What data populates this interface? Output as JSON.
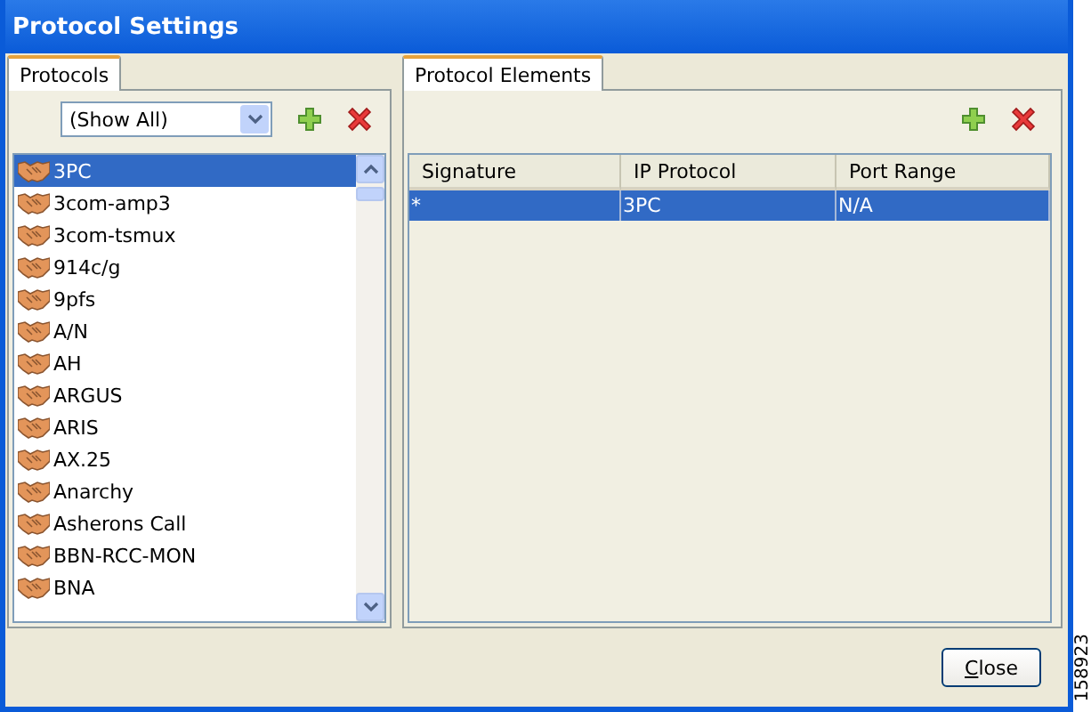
{
  "window": {
    "title": "Protocol Settings"
  },
  "protocols_panel": {
    "tabs": [
      {
        "label": "Protocols",
        "selected": true
      }
    ],
    "filter": {
      "value": "(Show All)"
    },
    "items": [
      {
        "label": "3PC",
        "selected": true
      },
      {
        "label": "3com-amp3",
        "selected": false
      },
      {
        "label": "3com-tsmux",
        "selected": false
      },
      {
        "label": "914c/g",
        "selected": false
      },
      {
        "label": "9pfs",
        "selected": false
      },
      {
        "label": "A/N",
        "selected": false
      },
      {
        "label": "AH",
        "selected": false
      },
      {
        "label": "ARGUS",
        "selected": false
      },
      {
        "label": "ARIS",
        "selected": false
      },
      {
        "label": "AX.25",
        "selected": false
      },
      {
        "label": "Anarchy",
        "selected": false
      },
      {
        "label": "Asherons Call",
        "selected": false
      },
      {
        "label": "BBN-RCC-MON",
        "selected": false
      },
      {
        "label": "BNA",
        "selected": false
      }
    ]
  },
  "elements_panel": {
    "tabs": [
      {
        "label": "Protocol Elements",
        "selected": true
      }
    ],
    "table": {
      "columns": [
        "Signature",
        "IP Protocol",
        "Port Range"
      ],
      "rows": [
        {
          "cells": [
            "*",
            "3PC",
            "N/A"
          ],
          "selected": true
        }
      ]
    }
  },
  "buttons": [
    {
      "label": "Close"
    }
  ],
  "figure_number": "158923"
}
